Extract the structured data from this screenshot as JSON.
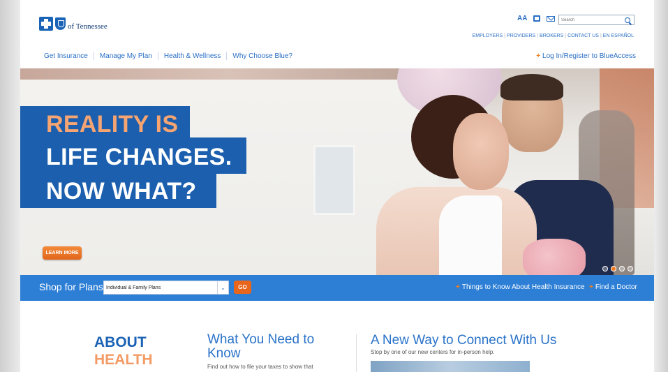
{
  "header": {
    "logo_text": "of Tennessee",
    "search_placeholder": "Search",
    "util_links": [
      "EMPLOYERS",
      "PROVIDERS",
      "BROKERS",
      "CONTACT US",
      "EN ESPAÑOL"
    ],
    "text_size_label": "AA"
  },
  "nav": {
    "items": [
      "Get Insurance",
      "Manage My Plan",
      "Health & Wellness",
      "Why Choose Blue?"
    ],
    "login": "Log In/Register to BlueAccess"
  },
  "hero": {
    "line1": "REALITY IS",
    "line2": "LIFE CHANGES.",
    "line3": "NOW WHAT?",
    "cta": "LEARN MORE",
    "slides": 4,
    "active_slide": 2
  },
  "shop": {
    "title": "Shop for Plans",
    "selected_plan": "Individual & Family Plans",
    "go": "GO",
    "link1": "Things to Know About Health Insurance",
    "link2": "Find a Doctor"
  },
  "lower": {
    "about_l1": "ABOUT",
    "about_l2": "HEALTH",
    "need_title": "What You Need to Know",
    "need_text": "Find out how to file your taxes to show that",
    "connect_title": "A New Way to Connect With Us",
    "connect_text": "Stop by one of our new centers for in-person help."
  },
  "colors": {
    "brand_blue": "#1b5fae",
    "accent_orange": "#e8661c",
    "bar_blue": "#2d7fd6"
  }
}
